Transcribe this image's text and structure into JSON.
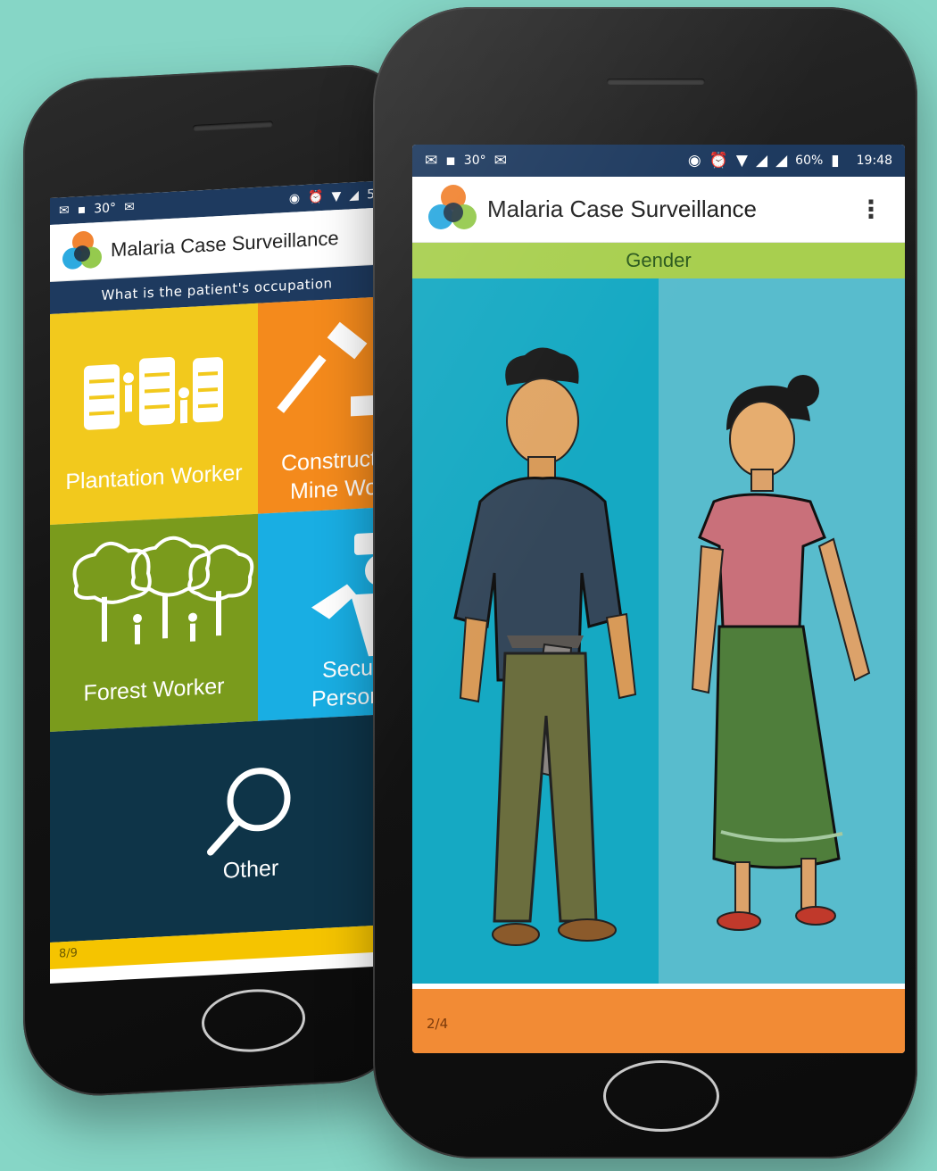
{
  "background_color": "#86d6c6",
  "back_phone": {
    "statusbar": {
      "left_icons": [
        "mail-icon",
        "image-icon",
        "temperature-icon",
        "mail-icon"
      ],
      "temperature": "30°",
      "right_icons": [
        "vibrate-icon",
        "alarm-icon",
        "wifi-icon",
        "signal-icon"
      ],
      "battery_partial": "5"
    },
    "appbar": {
      "title": "Malaria Case Surveillance"
    },
    "question": "What is the patient's occupation",
    "options": [
      {
        "label": "Plantation Worker",
        "color": "#f2c91d",
        "icon": "plantation-icon"
      },
      {
        "label": "Construct Mine Wo",
        "line1": "Construct",
        "line2": "Mine Wo",
        "color": "#f48a1c",
        "icon": "hammer-icon"
      },
      {
        "label": "Forest Worker",
        "color": "#7a9b1c",
        "icon": "trees-icon"
      },
      {
        "label": "Securi Person",
        "line1": "Securi",
        "line2": "Person",
        "color": "#19aee3",
        "icon": "guard-icon"
      }
    ],
    "other": {
      "label": "Other",
      "color": "#0e3448",
      "icon": "search-icon"
    },
    "progress": {
      "text": "8/9",
      "color": "#f5c400"
    }
  },
  "front_phone": {
    "statusbar": {
      "left_icons": [
        "mail-icon",
        "image-icon",
        "temperature-icon",
        "mail-icon"
      ],
      "temperature": "30°",
      "right_icons": [
        "vibrate-icon",
        "alarm-icon",
        "wifi-icon",
        "signal-icon",
        "signal-r-icon",
        "battery-icon"
      ],
      "battery": "60%",
      "time": "19:48"
    },
    "appbar": {
      "title": "Malaria Case Surveillance",
      "menu": "⋮"
    },
    "question": "Gender",
    "options": [
      {
        "name": "male",
        "color": "#15a9c3"
      },
      {
        "name": "female",
        "color": "#58bccd"
      }
    ],
    "progress": {
      "text": "2/4",
      "color": "#f28b35"
    }
  }
}
